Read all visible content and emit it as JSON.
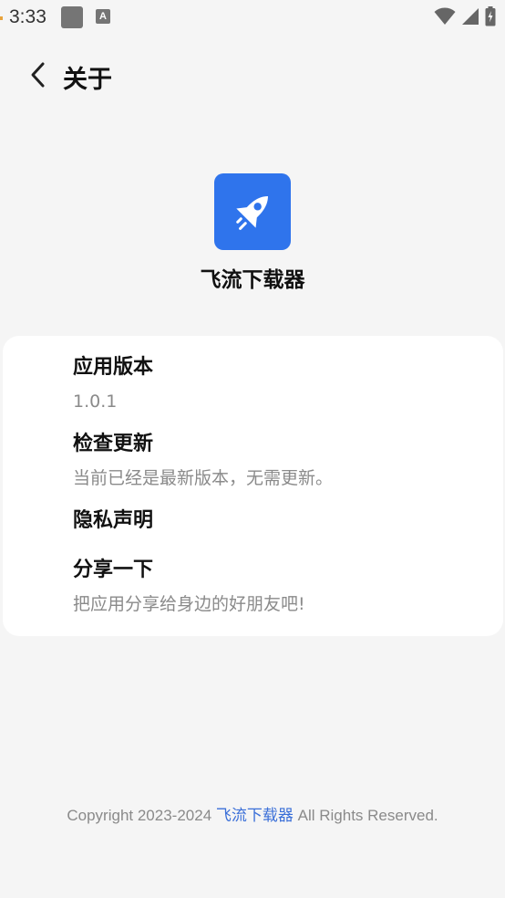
{
  "status_bar": {
    "time": "3:33",
    "notification_icons": [
      "gray-square-icon",
      "a-letter-icon"
    ],
    "notif_a_letter": "A",
    "right_icons": [
      "wifi-icon",
      "cell-signal-icon",
      "battery-icon"
    ]
  },
  "header": {
    "back_icon": "chevron-left-icon",
    "title": "关于"
  },
  "app": {
    "logo_icon": "rocket-icon",
    "logo_color": "#2f74ec",
    "name": "飞流下载器"
  },
  "card": {
    "items": [
      {
        "title": "应用版本",
        "subtitle": "1.0.1"
      },
      {
        "title": "检查更新",
        "subtitle": "当前已经是最新版本，无需更新。"
      },
      {
        "title": "隐私声明",
        "subtitle": ""
      },
      {
        "title": "分享一下",
        "subtitle": "把应用分享给身边的好朋友吧!"
      }
    ]
  },
  "footer": {
    "prefix": "Copyright 2023-2024 ",
    "link_text": "飞流下载器",
    "suffix": " All Rights Reserved.",
    "link_color": "#3a6fd8"
  }
}
